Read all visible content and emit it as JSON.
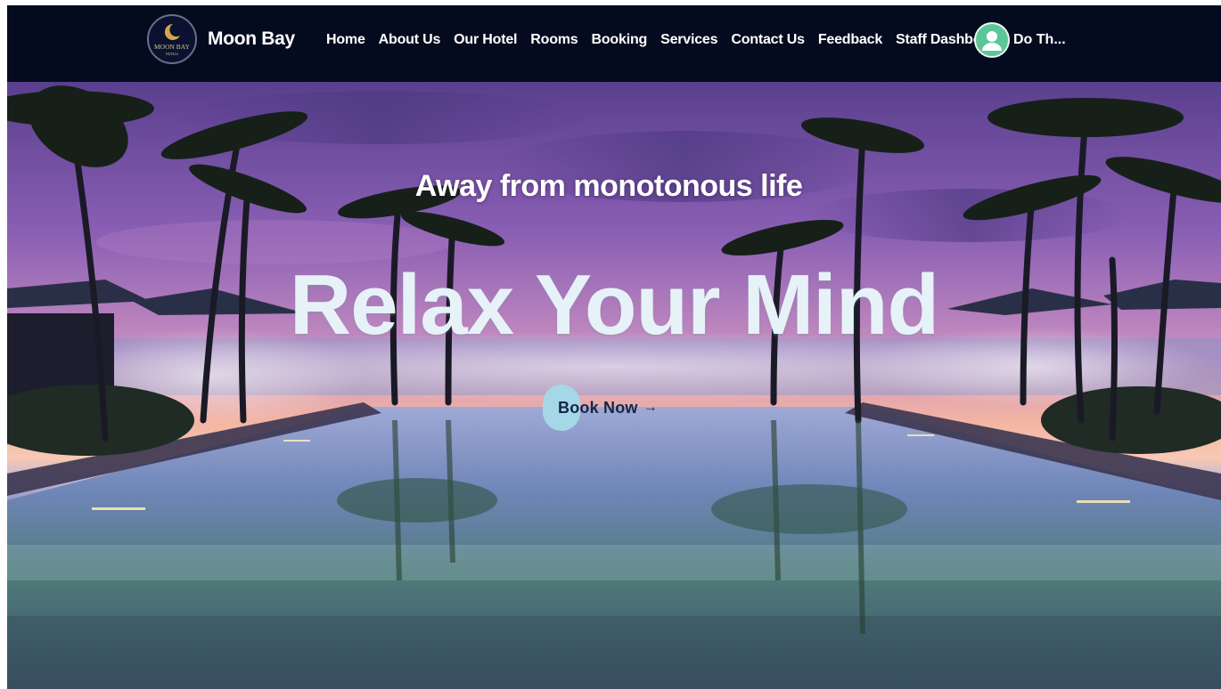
{
  "brand": {
    "name": "Moon Bay",
    "logo_text": "MOON BAY",
    "logo_subtext": "HOTELS"
  },
  "nav": {
    "items": [
      {
        "label": "Home"
      },
      {
        "label": "About Us"
      },
      {
        "label": "Our Hotel"
      },
      {
        "label": "Rooms"
      },
      {
        "label": "Booking"
      },
      {
        "label": "Services"
      },
      {
        "label": "Contact Us"
      },
      {
        "label": "Feedback"
      },
      {
        "label": "Staff Dashboard"
      }
    ]
  },
  "user": {
    "name": "Do Th...",
    "avatar_icon": "user-avatar-icon"
  },
  "hero": {
    "subtitle": "Away from monotonous life",
    "title": "Relax Your Mind",
    "cta_label": "Book Now",
    "cta_arrow": "→"
  },
  "colors": {
    "navbar_bg": "#050b1f",
    "avatar_bg": "#5cc69a",
    "cta_pill": "#a6d7e6",
    "cta_text": "#15264a"
  }
}
